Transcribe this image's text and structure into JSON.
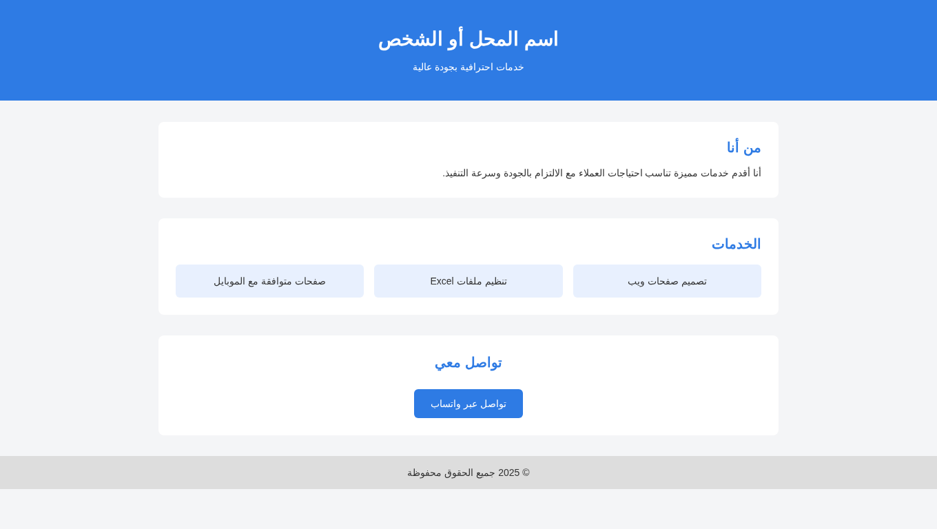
{
  "header": {
    "title": "اسم المحل أو الشخص",
    "subtitle": "خدمات احترافية بجودة عالية"
  },
  "sections": [
    {
      "kind": "about",
      "heading": "من أنا",
      "text": "أنا أقدم خدمات مميزة تناسب احتياجات العملاء مع الالتزام بالجودة وسرعة التنفيذ."
    },
    {
      "kind": "services",
      "heading": "الخدمات",
      "items": [
        "تصميم صفحات ويب",
        "تنظيم ملفات Excel",
        "صفحات متوافقة مع الموبايل"
      ]
    },
    {
      "kind": "contact",
      "heading": "تواصل معي",
      "button": "تواصل عبر واتساب"
    }
  ],
  "footer": {
    "text": "© 2025 جميع الحقوق محفوظة"
  }
}
